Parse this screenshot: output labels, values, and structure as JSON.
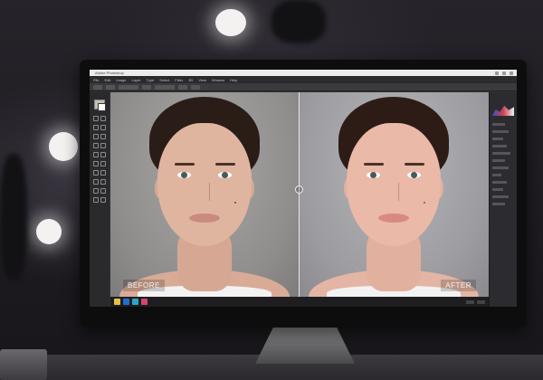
{
  "app": {
    "window_title": "Adobe Photoshop",
    "menu": [
      "File",
      "Edit",
      "Image",
      "Layer",
      "Type",
      "Select",
      "Filter",
      "3D",
      "View",
      "Window",
      "Help"
    ]
  },
  "canvas": {
    "before_label": "BEFORE",
    "after_label": "AFTER"
  },
  "colors": {
    "before_skin": "#e0b5a0",
    "after_skin": "#eab9a8",
    "before_lips": "#c98a80",
    "after_lips": "#d88a82"
  },
  "icons": {
    "compare_handle": "circle-handle-icon",
    "tools": "photoshop-toolbar-icons",
    "taskbar": [
      "file-explorer-icon",
      "photoshop-app-icon",
      "browser-icon",
      "paint-app-icon"
    ]
  }
}
